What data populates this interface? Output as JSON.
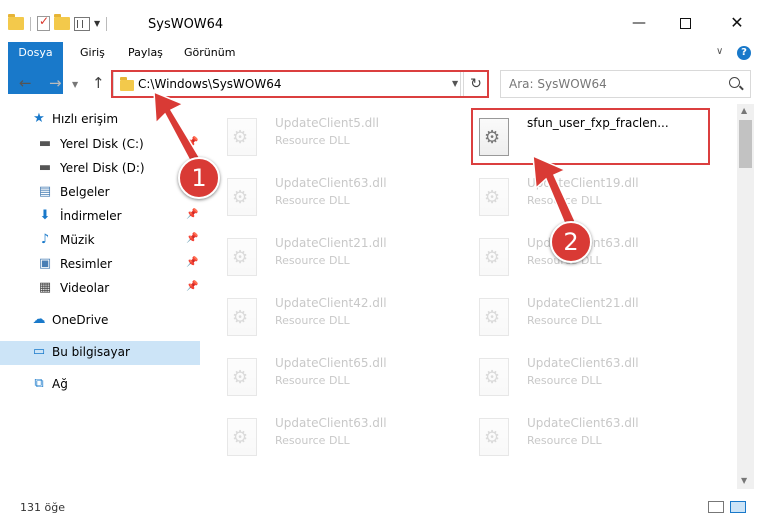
{
  "window": {
    "title": "SysWOW64",
    "min": "—",
    "close": "✕"
  },
  "ribbon": {
    "tabs": [
      {
        "label": "Dosya"
      },
      {
        "label": "Giriş"
      },
      {
        "label": "Paylaş"
      },
      {
        "label": "Görünüm"
      }
    ],
    "help": "?"
  },
  "nav": {
    "address": "C:\\Windows\\SysWOW64",
    "search_placeholder": "Ara: SysWOW64"
  },
  "sidebar": {
    "items": [
      {
        "label": "Hızlı erişim",
        "icon": "star-icon"
      },
      {
        "label": "Yerel Disk (C:)",
        "icon": "drive-icon"
      },
      {
        "label": "Yerel Disk (D:)",
        "icon": "drive-icon"
      },
      {
        "label": "Belgeler",
        "icon": "documents-icon"
      },
      {
        "label": "İndirmeler",
        "icon": "download-icon"
      },
      {
        "label": "Müzik",
        "icon": "music-icon"
      },
      {
        "label": "Resimler",
        "icon": "pictures-icon"
      },
      {
        "label": "Videolar",
        "icon": "video-icon"
      },
      {
        "label": "OneDrive",
        "icon": "cloud-icon"
      },
      {
        "label": "Bu bilgisayar",
        "icon": "computer-icon"
      },
      {
        "label": "Ağ",
        "icon": "network-icon"
      }
    ]
  },
  "files": {
    "left": [
      {
        "name": "UpdateClient5.dll",
        "type": "Resource DLL"
      },
      {
        "name": "UpdateClient63.dll",
        "type": "Resource DLL"
      },
      {
        "name": "UpdateClient21.dll",
        "type": "Resource DLL"
      },
      {
        "name": "UpdateClient42.dll",
        "type": "Resource DLL"
      },
      {
        "name": "UpdateClient65.dll",
        "type": "Resource DLL"
      },
      {
        "name": "UpdateClient63.dll",
        "type": "Resource DLL"
      }
    ],
    "right": [
      {
        "name": "sfun_user_fxp_fraclen...",
        "type": ""
      },
      {
        "name": "UpdateClient19.dll",
        "type": "Resource DLL"
      },
      {
        "name": "UpdateClient63.dll",
        "type": "Resource DLL"
      },
      {
        "name": "UpdateClient21.dll",
        "type": "Resource DLL"
      },
      {
        "name": "UpdateClient63.dll",
        "type": "Resource DLL"
      },
      {
        "name": "UpdateClient63.dll",
        "type": "Resource DLL"
      }
    ]
  },
  "status": {
    "count": "131 öğe"
  },
  "callouts": {
    "one": "1",
    "two": "2"
  },
  "colors": {
    "accent": "#1979ca",
    "highlight": "#db3f3f",
    "selected": "#cce4f7"
  }
}
